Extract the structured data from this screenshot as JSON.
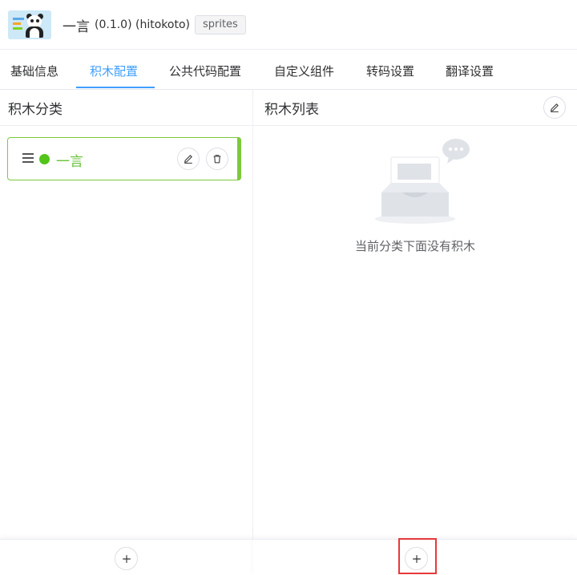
{
  "header": {
    "title": "一言",
    "meta": "(0.1.0) (hitokoto)",
    "tag": "sprites"
  },
  "tabs": [
    {
      "label": "基础信息",
      "active": false
    },
    {
      "label": "积木配置",
      "active": true
    },
    {
      "label": "公共代码配置",
      "active": false
    },
    {
      "label": "自定义组件",
      "active": false
    },
    {
      "label": "转码设置",
      "active": false
    },
    {
      "label": "翻译设置",
      "active": false
    }
  ],
  "left_panel": {
    "title": "积木分类",
    "categories": [
      {
        "label": "一言",
        "color": "#52c41a"
      }
    ]
  },
  "right_panel": {
    "title": "积木列表",
    "empty_text": "当前分类下面没有积木"
  },
  "icons": {
    "edit": "pencil-icon",
    "delete": "trash-icon",
    "add": "plus-icon",
    "drag": "drag-handle-icon",
    "empty": "empty-inbox-icon"
  },
  "colors": {
    "accent": "#409eff",
    "category_green": "#67c23a",
    "highlight_red": "#e5393a"
  }
}
